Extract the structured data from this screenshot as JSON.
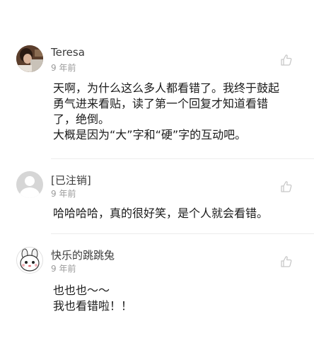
{
  "comments": [
    {
      "username": "Teresa",
      "time": "9 年前",
      "lines": [
        "天啊，为什么这么多人都看错了。我终于鼓起",
        "勇气进来看贴，读了第一个回复才知道看错",
        "了，绝倒。",
        "大概是因为“大”字和“硬”字的互动吧。"
      ]
    },
    {
      "username": "[已注销]",
      "time": "9 年前",
      "lines": [
        "哈哈哈哈，真的很好笑，是个人就会看错。"
      ]
    },
    {
      "username": "快乐的跳跳兔",
      "time": "9 年前",
      "lines": [
        "也也也～～",
        "我也看错啦！！"
      ]
    }
  ],
  "icons": {
    "like": "thumbs-up-icon",
    "default_avatar": "user-placeholder-icon"
  },
  "colors": {
    "username": "#3a3a3a",
    "time": "#9a9a9a",
    "text": "#1a1a1a",
    "divider": "#ececec",
    "icon": "#c8c8c8"
  }
}
